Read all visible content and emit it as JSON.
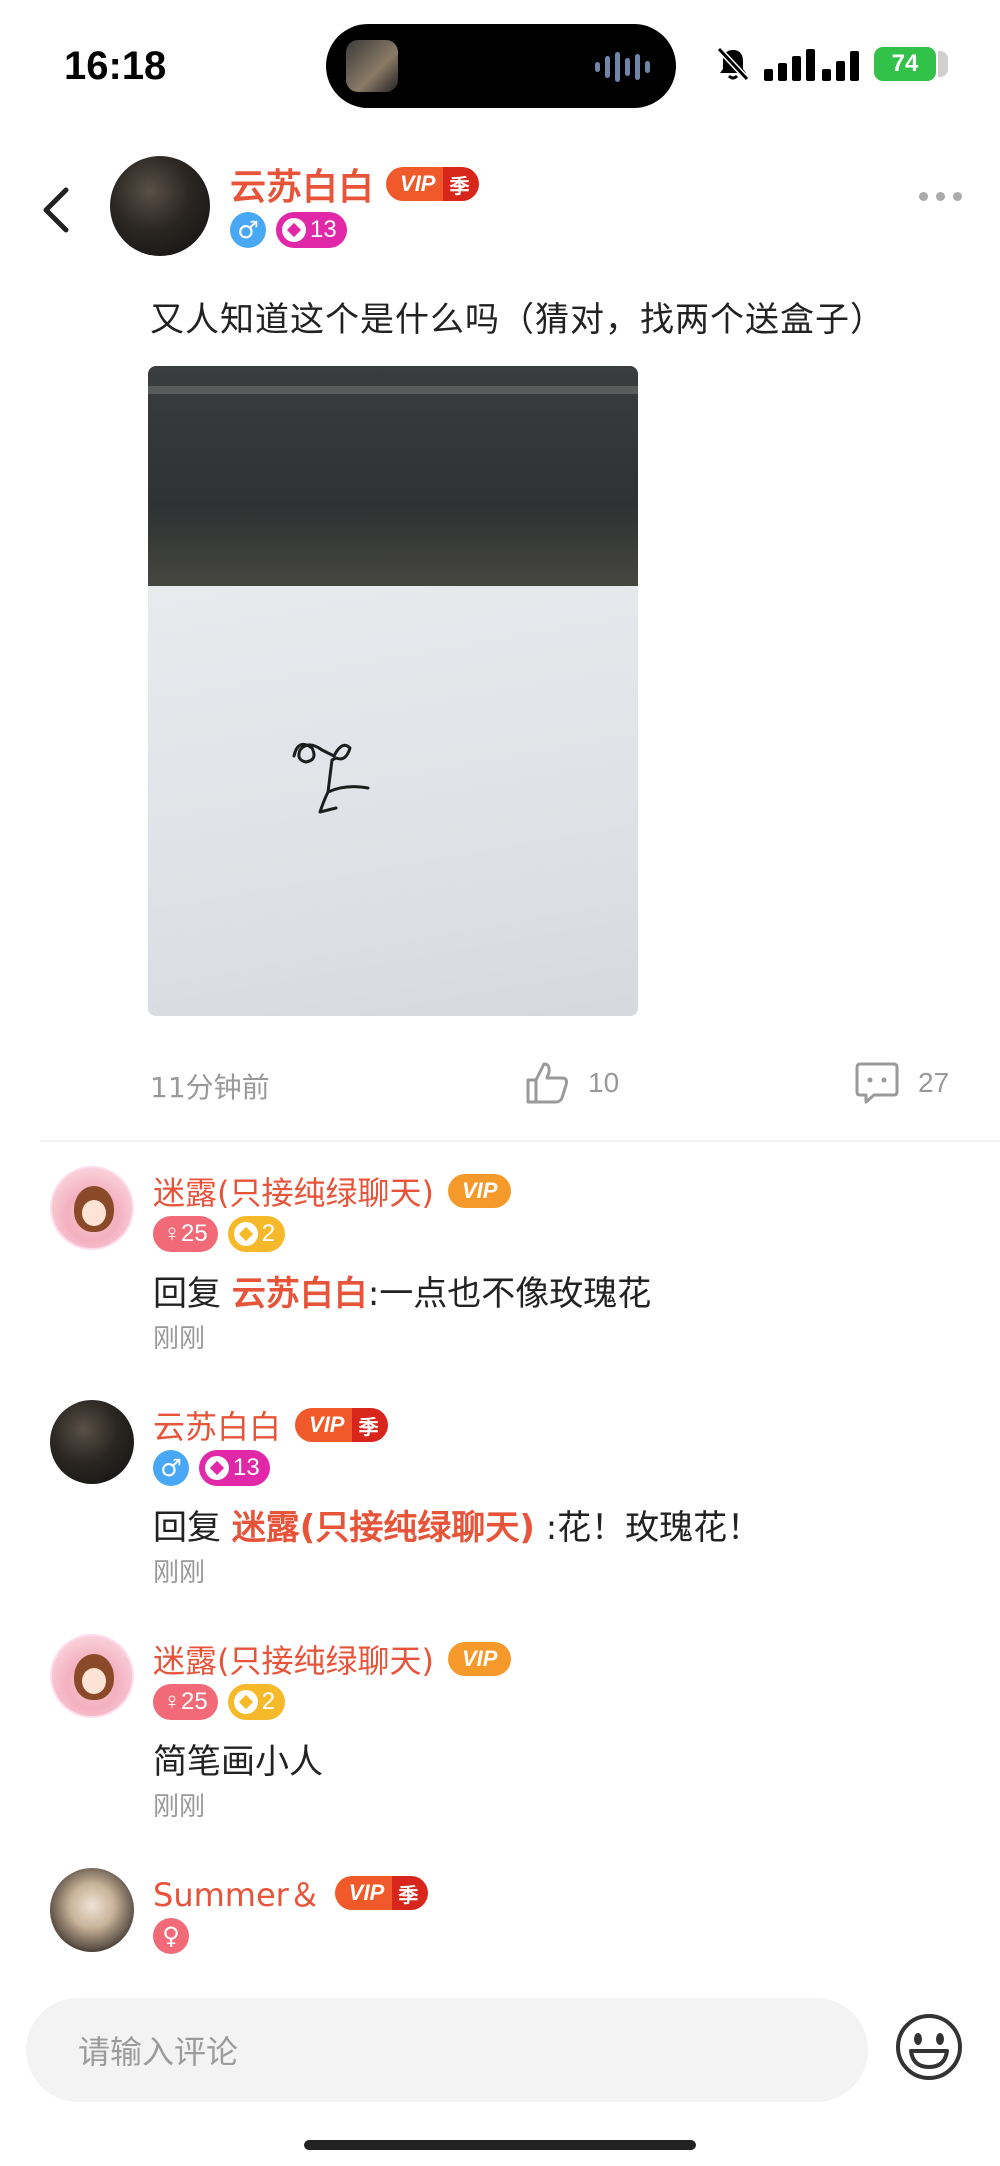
{
  "status_bar": {
    "time": "16:18",
    "battery": "74",
    "icons": [
      "mute-bell-icon",
      "signal-icon",
      "battery-icon"
    ]
  },
  "post": {
    "author": "云苏白白",
    "vip_label": "VIP",
    "vip_season": "季",
    "level": "13",
    "text": "又人知道这个是什么吗（猜对，找两个送盒子）",
    "time": "11分钟前",
    "likes": "10",
    "comments": "27"
  },
  "comments": [
    {
      "name": "迷露(只接纯绿聊天)",
      "vip_label": "VIP",
      "gender_age": "♀25",
      "level": "2",
      "reply_prefix": "回复 ",
      "mention": "云苏白白",
      "text": ":一点也不像玫瑰花",
      "time": "刚刚"
    },
    {
      "name": "云苏白白",
      "vip_label": "VIP",
      "vip_season": "季",
      "level": "13",
      "reply_prefix": "回复 ",
      "mention": "迷露(只接纯绿聊天)",
      "text": " :花！玫瑰花！",
      "time": "刚刚"
    },
    {
      "name": "迷露(只接纯绿聊天)",
      "vip_label": "VIP",
      "gender_age": "♀25",
      "level": "2",
      "text": "简笔画小人",
      "time": "刚刚"
    },
    {
      "name": "Summer＆",
      "vip_label": "VIP",
      "vip_season": "季",
      "gender": "♀"
    }
  ],
  "input": {
    "placeholder": "请输入评论"
  },
  "colors": {
    "name_accent": "#e8543a",
    "vip_red": "#f05a2a",
    "vip_orange": "#f59a2a",
    "level_pink": "#e028a8",
    "level_yellow": "#f5b92a",
    "gender_female": "#f26a77",
    "gender_male": "#49a8f5",
    "battery_green": "#32c24a"
  }
}
